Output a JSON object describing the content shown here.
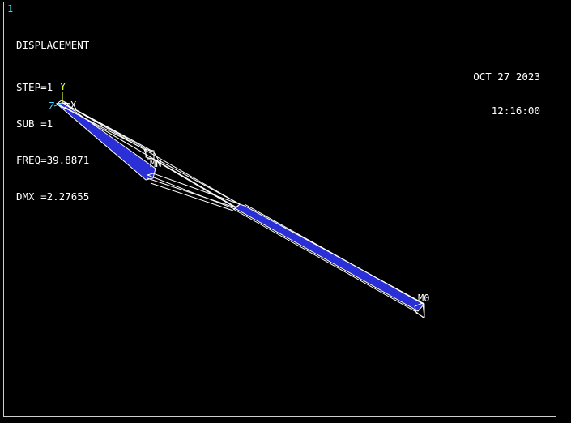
{
  "window": {
    "number": "1"
  },
  "info": {
    "title": "DISPLACEMENT",
    "step": "STEP=1",
    "sub": "SUB =1",
    "freq": "FREQ=39.8871",
    "dmx": "DMX =2.27655"
  },
  "timestamp": {
    "date": "OCT 27 2023",
    "time": "12:16:00"
  },
  "markers": {
    "upper": "MN",
    "lower": "M0"
  },
  "axes": {
    "y": "Y",
    "z": "Z",
    "x": "X"
  },
  "colors": {
    "background": "#000000",
    "deformed_fill": "#2a2fd6",
    "undeformed_line": "#ffffff",
    "axis_y": "#d8ff3a",
    "axis_z": "#3fd6ff",
    "window_number": "#3fd6ff"
  }
}
